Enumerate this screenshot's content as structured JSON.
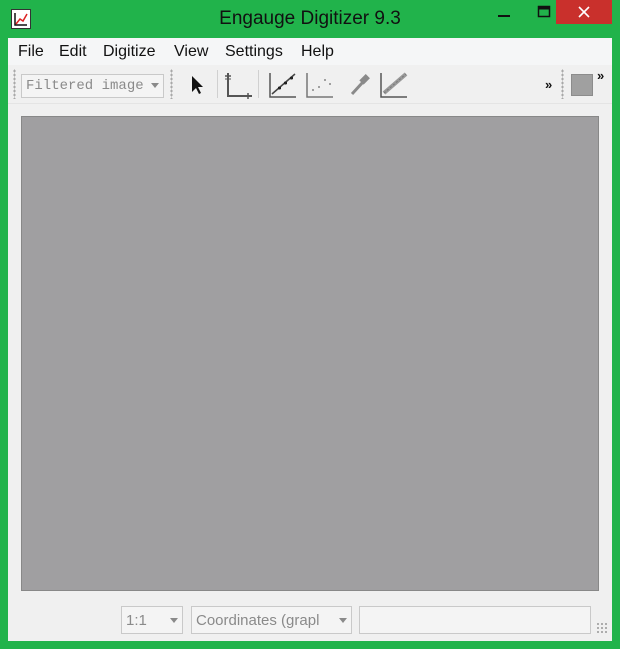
{
  "window": {
    "title": "Engauge Digitizer 9.3",
    "controls": {
      "minimize": "—",
      "maximize": "☐",
      "close": "✕"
    },
    "accent_color": "#21b34b",
    "close_color": "#c9302c"
  },
  "menubar": {
    "items": [
      {
        "label": "File"
      },
      {
        "label": "Edit"
      },
      {
        "label": "Digitize"
      },
      {
        "label": "View"
      },
      {
        "label": "Settings"
      },
      {
        "label": "Help"
      }
    ]
  },
  "toolbar": {
    "background_combo": {
      "value": "Filtered image"
    },
    "tools": [
      {
        "name": "select-tool-icon"
      },
      {
        "name": "axis-point-tool-icon"
      },
      {
        "name": "curve-point-tool-icon"
      },
      {
        "name": "point-match-tool-icon"
      },
      {
        "name": "color-picker-tool-icon"
      },
      {
        "name": "segment-fill-tool-icon"
      }
    ],
    "overflow": "»",
    "overflow2": "»"
  },
  "canvas": {
    "color": "#a09fa1"
  },
  "statusbar": {
    "zoom_combo": {
      "value": "1:1"
    },
    "coordinates_combo": {
      "value": "Coordinates (grapl"
    },
    "status_text": ""
  }
}
